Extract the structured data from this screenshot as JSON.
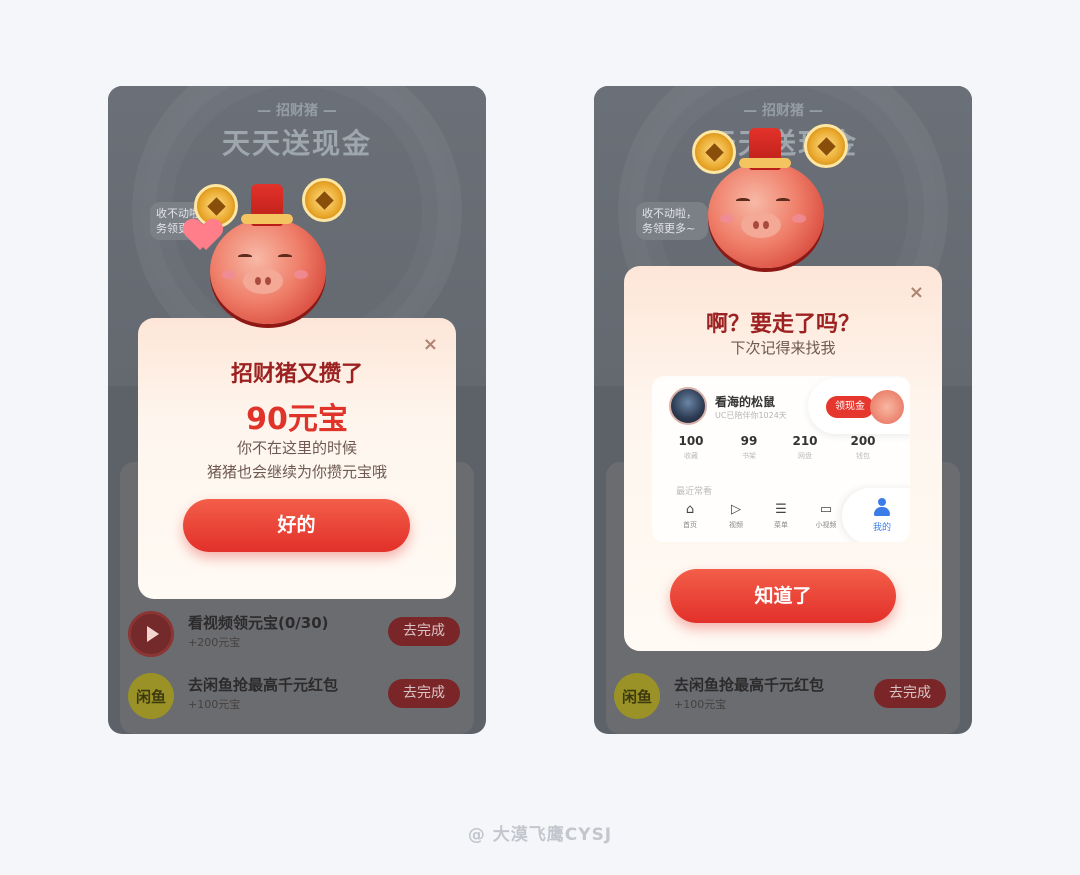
{
  "left_screen": {
    "header_subtitle": "— 招财猪 —",
    "header_title": "天天送现金",
    "speech_bubble": "收不动啦，务领更多",
    "tasks": [
      {
        "title": "看视频领元宝(0/30)",
        "reward": "+200元宝",
        "button": "去完成",
        "icon": "video-play-icon"
      },
      {
        "title": "去闲鱼抢最高千元红包",
        "reward": "+100元宝",
        "button": "去完成",
        "icon": "xianyu-icon",
        "icon_text": "闲鱼"
      }
    ],
    "dialog": {
      "title": "招财猪又攒了",
      "amount": "90元宝",
      "line1": "你不在这里的时候",
      "line2": "猪猪也会继续为你攒元宝哦",
      "confirm": "好的",
      "close": "×"
    }
  },
  "right_screen": {
    "header_subtitle": "— 招财猪 —",
    "header_title": "天天送现金",
    "speech_bubble": "收不动啦，务领更多~",
    "tasks": [
      {
        "title": "去闲鱼抢最高千元红包",
        "reward": "+100元宝",
        "button": "去完成",
        "icon": "xianyu-icon",
        "icon_text": "闲鱼"
      }
    ],
    "dialog": {
      "title": "啊？要走了吗？",
      "subtitle": "下次记得来找我",
      "confirm": "知道了",
      "close": "×",
      "profile": {
        "name": "看海的松鼠",
        "sub": "UC已陪伴你1024天",
        "cash_button": "领现金",
        "stats": [
          {
            "value": "100",
            "label": "收藏"
          },
          {
            "value": "99",
            "label": "书架"
          },
          {
            "value": "210",
            "label": "网盘"
          },
          {
            "value": "200",
            "label": "钱包"
          }
        ],
        "recent_label": "最近常看",
        "nav": [
          {
            "label": "首页",
            "icon": "home-icon",
            "glyph": "⌂"
          },
          {
            "label": "视频",
            "icon": "play-icon",
            "glyph": "▷"
          },
          {
            "label": "菜单",
            "icon": "menu-icon",
            "glyph": "☰"
          },
          {
            "label": "小视频",
            "icon": "mini-video-icon",
            "glyph": "▭"
          },
          {
            "label": "我的",
            "icon": "user-icon",
            "active": true
          }
        ]
      }
    }
  },
  "watermark": "@ 大漠飞鹰CYSJ",
  "colors": {
    "accent": "#e2302a",
    "title_red": "#9c2222",
    "active_blue": "#3c7ce6"
  }
}
